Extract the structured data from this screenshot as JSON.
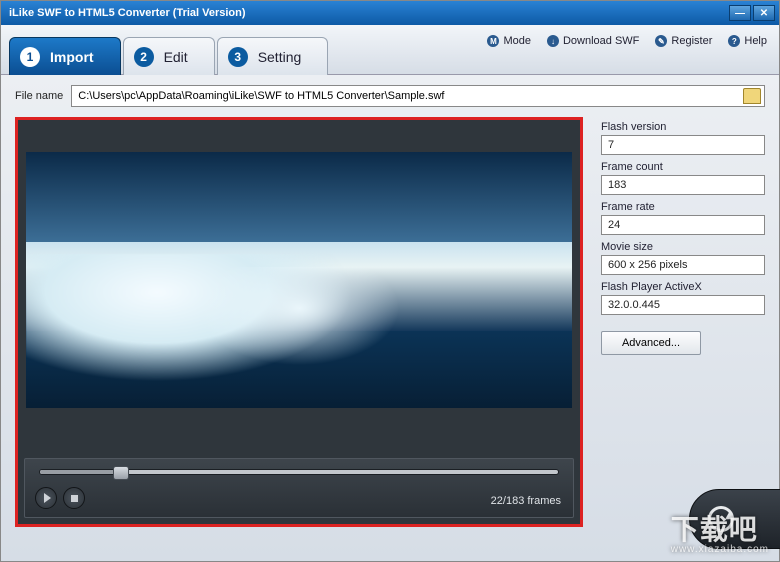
{
  "window": {
    "title": "iLike SWF to HTML5 Converter (Trial Version)"
  },
  "tabs": {
    "import": "Import",
    "edit": "Edit",
    "setting": "Setting"
  },
  "toplinks": {
    "mode": "Mode",
    "download": "Download SWF",
    "register": "Register",
    "help": "Help"
  },
  "file": {
    "label": "File name",
    "path": "C:\\Users\\pc\\AppData\\Roaming\\iLike\\SWF to HTML5 Converter\\Sample.swf"
  },
  "playback": {
    "position_text": "22/183 frames"
  },
  "info": {
    "flash_version_label": "Flash version",
    "flash_version": "7",
    "frame_count_label": "Frame count",
    "frame_count": "183",
    "frame_rate_label": "Frame rate",
    "frame_rate": "24",
    "movie_size_label": "Movie size",
    "movie_size": "600 x 256 pixels",
    "activex_label": "Flash Player ActiveX",
    "activex": "32.0.0.445",
    "advanced": "Advanced..."
  },
  "watermark": {
    "text": "下载吧",
    "url": "www.xiazaiba.com"
  }
}
